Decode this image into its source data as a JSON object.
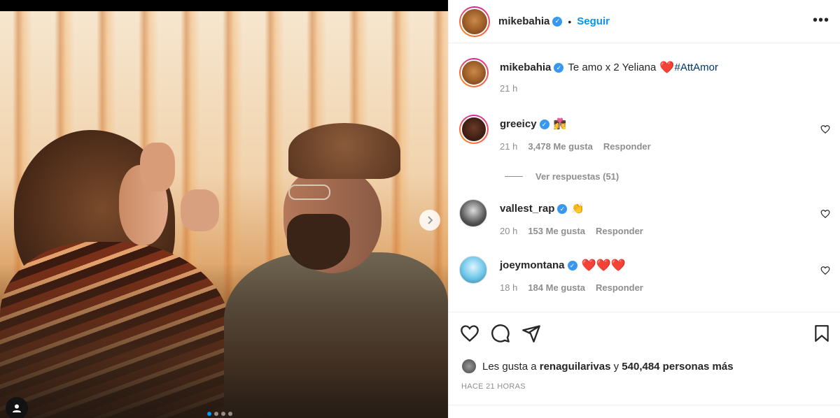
{
  "post": {
    "author": "mikebahia",
    "follow_label": "Seguir",
    "separator": "•",
    "more_label": "•••",
    "caption_text": "Te amo x 2 Yeliana",
    "caption_heart": "❤️",
    "caption_tag": "#AttAmor",
    "caption_time": "21 h"
  },
  "comments": [
    {
      "user": "greeicy",
      "text": "👩‍❤️‍💋‍👨",
      "time": "21 h",
      "likes": "3,478 Me gusta",
      "reply": "Responder"
    },
    {
      "user": "vallest_rap",
      "text": "👏",
      "time": "20 h",
      "likes": "153 Me gusta",
      "reply": "Responder"
    },
    {
      "user": "joeymontana",
      "text": "❤️❤️❤️",
      "time": "18 h",
      "likes": "184 Me gusta",
      "reply": "Responder"
    }
  ],
  "view_replies": "Ver respuestas (51)",
  "likes_line": {
    "prefix": "Les gusta a",
    "user": "renaguilarivas",
    "conj": "y",
    "count": "540,484 personas más"
  },
  "timestamp": "HACE 21 HORAS",
  "carousel": {
    "total": 4,
    "active": 0
  },
  "colors": {
    "link": "#0095f6",
    "verified": "#3897f0",
    "heart": "#ed1c3a",
    "muted": "#8e8e8e"
  }
}
